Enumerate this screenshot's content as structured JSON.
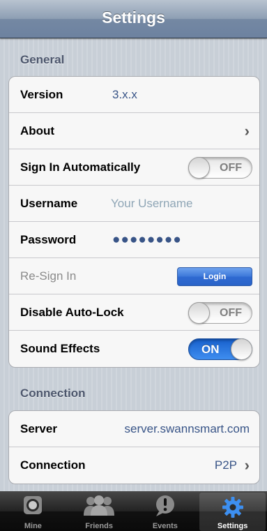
{
  "navbar": {
    "title": "Settings"
  },
  "sections": {
    "general": "General",
    "connection": "Connection"
  },
  "general": {
    "version_label": "Version",
    "version_value": "3.x.x",
    "about_label": "About",
    "sign_in_auto_label": "Sign In Automatically",
    "sign_in_auto_state": "OFF",
    "username_label": "Username",
    "username_placeholder": "Your Username",
    "password_label": "Password",
    "password_value": "●●●●●●●●",
    "resign_label": "Re-Sign In",
    "login_button": "Login",
    "auto_lock_label": "Disable Auto-Lock",
    "auto_lock_state": "OFF",
    "sound_label": "Sound Effects",
    "sound_state": "ON"
  },
  "connection": {
    "server_label": "Server",
    "server_value": "server.swannsmart.com",
    "connection_label": "Connection",
    "connection_value": "P2P"
  },
  "tabbar": {
    "items": [
      {
        "label": "Mine",
        "icon": "camera-icon"
      },
      {
        "label": "Friends",
        "icon": "friends-icon"
      },
      {
        "label": "Events",
        "icon": "alert-icon"
      },
      {
        "label": "Settings",
        "icon": "gear-icon"
      }
    ]
  },
  "colors": {
    "accent": "#2f6ad2",
    "value_text": "#385487",
    "toggle_on": "#1760cc"
  }
}
